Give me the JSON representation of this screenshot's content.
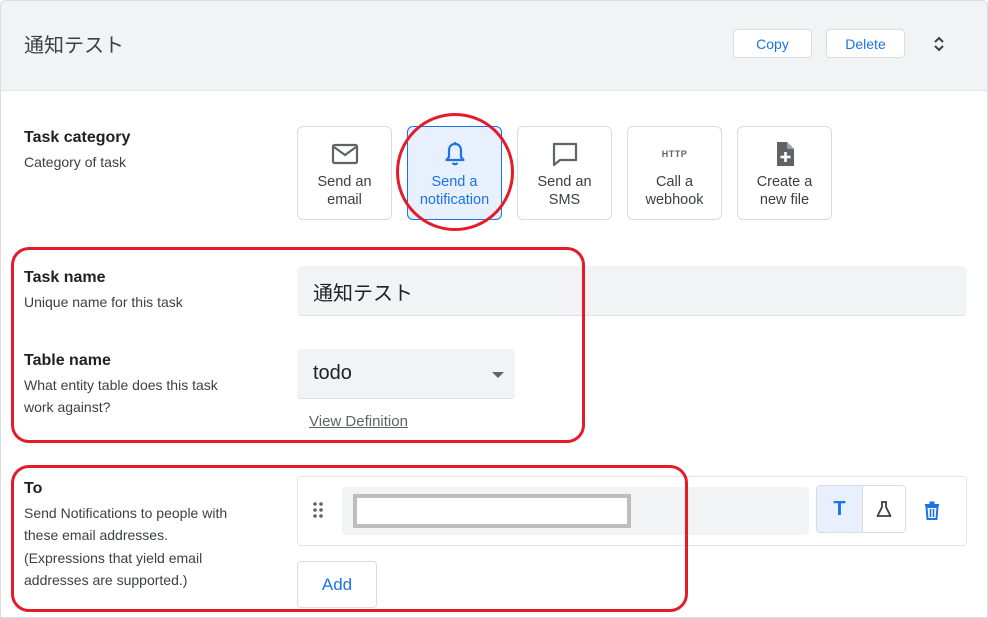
{
  "header": {
    "title": "通知テスト",
    "copy_label": "Copy",
    "delete_label": "Delete"
  },
  "task_category": {
    "title": "Task category",
    "description": "Category of task",
    "options": [
      {
        "line1": "Send an",
        "line2": "email",
        "icon": "mail-icon",
        "selected": false
      },
      {
        "line1": "Send a",
        "line2": "notification",
        "icon": "bell-icon",
        "selected": true
      },
      {
        "line1": "Send an",
        "line2": "SMS",
        "icon": "chat-icon",
        "selected": false
      },
      {
        "line1": "Call a",
        "line2": "webhook",
        "icon": "http-icon",
        "icon_text": "HTTP",
        "selected": false
      },
      {
        "line1": "Create a",
        "line2": "new file",
        "icon": "new-file-icon",
        "selected": false
      }
    ]
  },
  "task_name": {
    "title": "Task name",
    "description": "Unique name for this task",
    "value": "通知テスト"
  },
  "table_name": {
    "title": "Table name",
    "description_line1": "What entity table does this task",
    "description_line2": "work against?",
    "value": "todo",
    "link": "View Definition"
  },
  "to": {
    "title": "To",
    "description_lines": [
      "Send Notifications to people with",
      "these email addresses.",
      "(Expressions that yield email",
      "addresses are supported.)"
    ],
    "value": "",
    "mode_text_icon": "T",
    "add_label": "Add"
  },
  "colors": {
    "accent": "#1a73e8",
    "annotation": "#e41c2a",
    "header_bg": "#f1f3f4"
  }
}
